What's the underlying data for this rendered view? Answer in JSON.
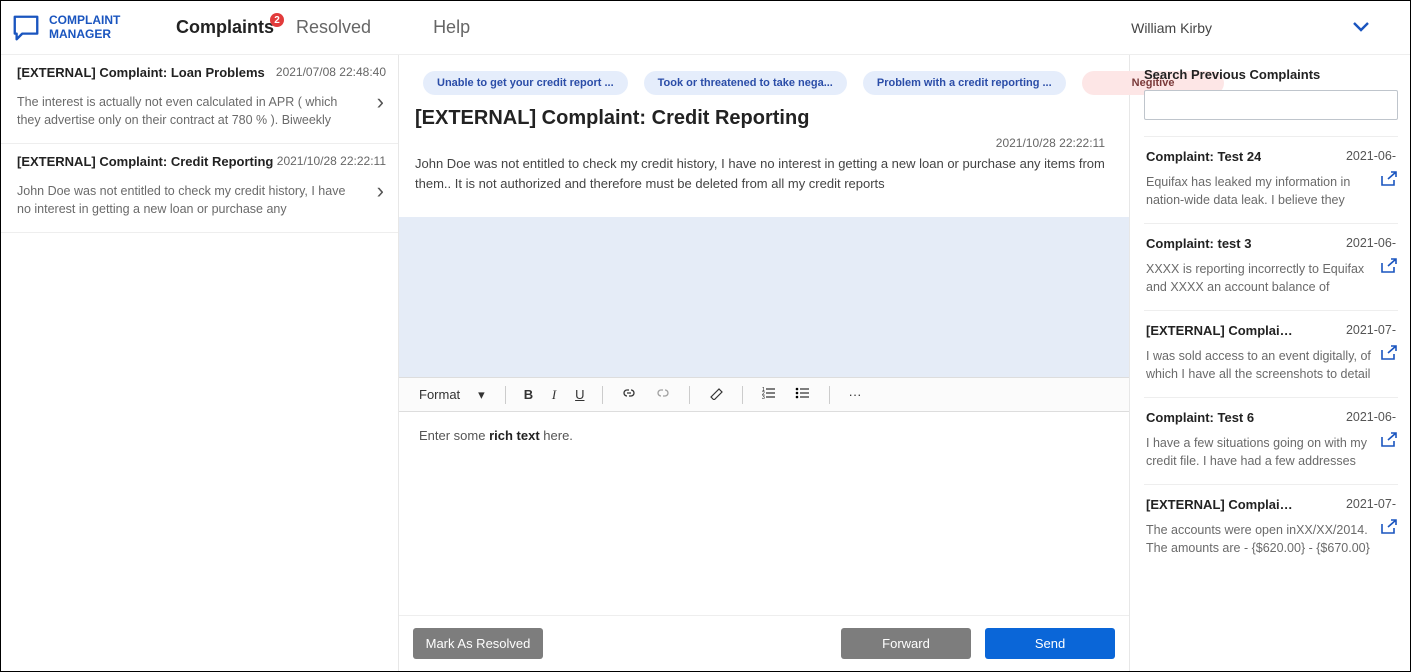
{
  "app": {
    "name_line1": "COMPLAINT",
    "name_line2": "MANAGER"
  },
  "nav": {
    "complaints": "Complaints",
    "complaints_badge": "2",
    "resolved": "Resolved",
    "help": "Help"
  },
  "user": {
    "name": "William Kirby"
  },
  "inbox": [
    {
      "title": "[EXTERNAL] Complaint: Loan Problems",
      "date": "2021/07/08 22:48:40",
      "body": "The interest is actually not even calculated in APR ( which they advertise only on their contract at 780 % ). Biweekly"
    },
    {
      "title": "[EXTERNAL] Complaint: Credit Reporting",
      "date": "2021/10/28 22:22:11",
      "body": "John Doe  was not entitled to check my credit history, I have no interest in getting a new loan or purchase any"
    }
  ],
  "tags": [
    "Unable to get your credit report ...",
    "Took or threatened to take nega...",
    "Problem with a credit reporting ..."
  ],
  "sentiment": "Negitive",
  "detail": {
    "title": "[EXTERNAL] Complaint: Credit Reporting",
    "date": "2021/10/28 22:22:11",
    "body": "John Doe  was not entitled to check my credit history, I have no interest in getting a new loan or purchase any items from them.. It is not authorized and therefore must be deleted from all my credit reports"
  },
  "editor": {
    "format_label": "Format",
    "placeholder_pre": "Enter some ",
    "placeholder_bold": "rich text",
    "placeholder_post": " here."
  },
  "actions": {
    "resolve": "Mark As Resolved",
    "forward": "Forward",
    "send": "Send"
  },
  "search": {
    "label": "Search Previous Complaints"
  },
  "previous": [
    {
      "title": "Complaint: Test 24",
      "date": "2021-06-",
      "body": "Equifax has leaked my information in nation-wide data leak. I believe they"
    },
    {
      "title": "Complaint: test 3",
      "date": "2021-06-",
      "body": "XXXX is reporting incorrectly to Equifax and XXXX an account balance of"
    },
    {
      "title": "[EXTERNAL] Complain...",
      "date": "2021-07-",
      "body": "I was sold access to an event digitally, of which I have all the screenshots to detail"
    },
    {
      "title": "Complaint: Test 6",
      "date": "2021-06-",
      "body": "I have a few situations going on with my credit file. I have had a few addresses"
    },
    {
      "title": "[EXTERNAL] Complain...",
      "date": "2021-07-",
      "body": "The accounts were open inXX/XX/2014. The amounts are - {$620.00} - {$670.00}"
    }
  ]
}
